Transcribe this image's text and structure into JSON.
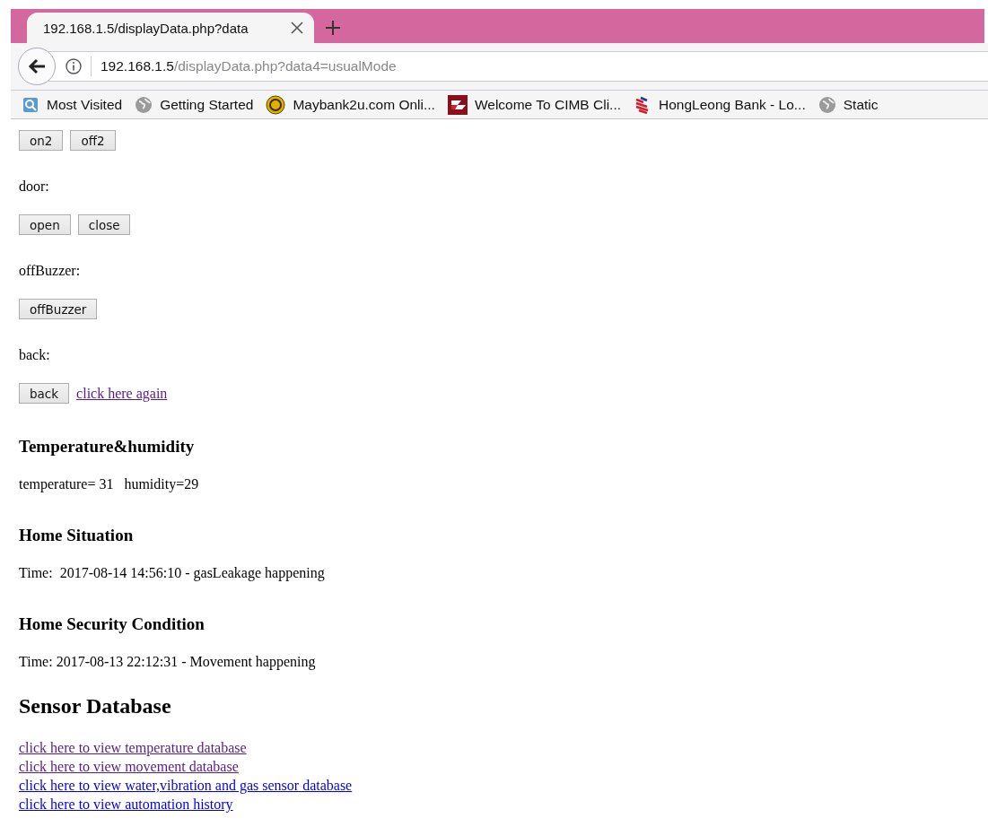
{
  "browser": {
    "tab": {
      "title": "192.168.1.5/displayData.php?data",
      "selected": true
    },
    "address": {
      "host": "192.168.1.5",
      "path": "/displayData.php?data4=usualMode"
    },
    "bookmarks": [
      {
        "kind": "folder",
        "label": "Most Visited"
      },
      {
        "kind": "globe",
        "label": "Getting Started"
      },
      {
        "kind": "coin",
        "label": "Maybank2u.com Onli..."
      },
      {
        "kind": "flag",
        "label": "Welcome To CIMB Cli..."
      },
      {
        "kind": "stripes",
        "label": "HongLeong Bank - Lo..."
      },
      {
        "kind": "globe",
        "label": "Static"
      }
    ]
  },
  "page": [
    {
      "kind": "buttons",
      "buttons": [
        "on2",
        "off2"
      ]
    },
    {
      "kind": "label",
      "text": "door:"
    },
    {
      "kind": "buttons",
      "buttons": [
        "open",
        "close"
      ]
    },
    {
      "kind": "label",
      "text": "offBuzzer:"
    },
    {
      "kind": "buttons",
      "buttons": [
        "offBuzzer"
      ]
    },
    {
      "kind": "label",
      "text": "back:"
    },
    {
      "kind": "buttons",
      "buttons": [
        "back"
      ],
      "link": {
        "text": "click here again",
        "visited": true
      }
    },
    {
      "kind": "heading",
      "text": "Temperature&humidity"
    },
    {
      "kind": "text",
      "text": "temperature= 31   humidity=29"
    },
    {
      "kind": "heading",
      "text": "Home Situation"
    },
    {
      "kind": "text",
      "text": "Time:  2017-08-14 14:56:10 - gasLeakage happening"
    },
    {
      "kind": "heading",
      "text": "Home Security Condition"
    },
    {
      "kind": "text",
      "text": "Time: 2017-08-13 22:12:31 - Movement happening"
    },
    {
      "kind": "title",
      "text": "Sensor Database"
    },
    {
      "kind": "links",
      "links": [
        {
          "text": "click here to view temperature database",
          "visited": true
        },
        {
          "text": "click here to view movement database",
          "visited": true
        },
        {
          "text": "click here to view water,vibration and gas sensor database",
          "visited": false
        },
        {
          "text": "click here to view automation history",
          "visited": false
        }
      ]
    }
  ]
}
